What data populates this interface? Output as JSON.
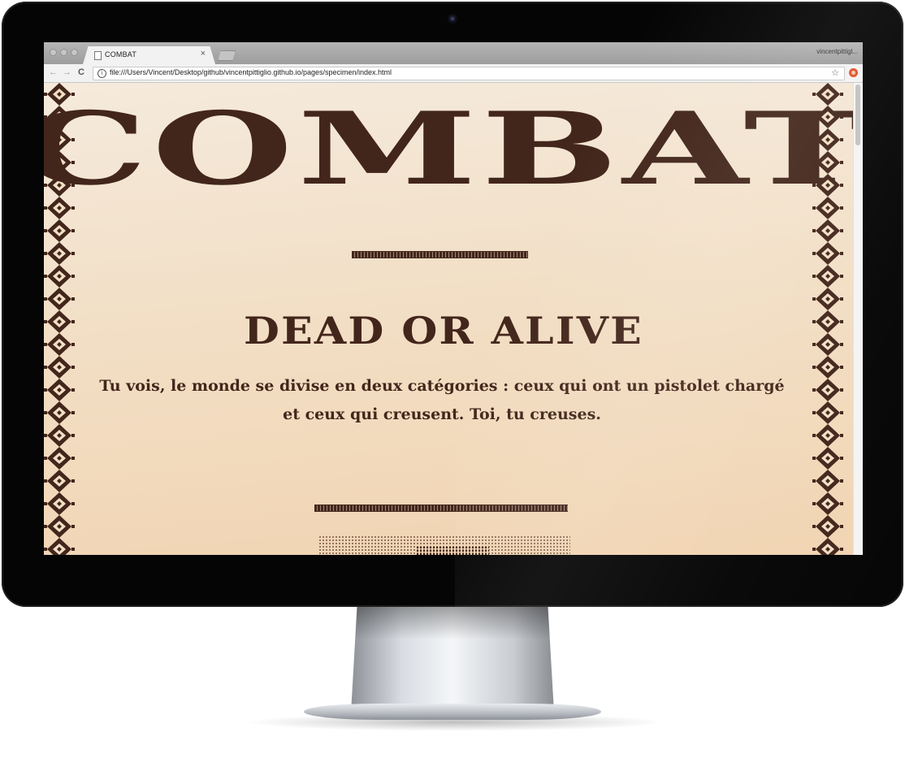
{
  "browser": {
    "tab_title": "COMBAT",
    "tab_close": "×",
    "profile_label": "vincentpittigl...",
    "nav": {
      "back": "←",
      "forward": "→",
      "reload": "C"
    },
    "url": "file:///Users/Vincent/Desktop/github/vincentpittiglio.github.io/pages/specimen/index.html",
    "info_glyph": "i",
    "bookmark_glyph": "☆"
  },
  "page": {
    "title": "COMBAT",
    "subtitle": "DEAD OR ALIVE",
    "quote_line1": "Tu vois, le monde se divise en deux catégories : ceux qui ont un pistolet chargé",
    "quote_line2": "et ceux qui creusent. Toi, tu creuses."
  },
  "colors": {
    "ink": "#43261b",
    "paper": "#f2dfc6",
    "bezel": "#050505"
  },
  "icons": [
    "document-icon",
    "close-icon",
    "new-tab-icon",
    "back-icon",
    "forward-icon",
    "reload-icon",
    "info-icon",
    "star-icon",
    "extension-icon",
    "webcam-icon"
  ]
}
